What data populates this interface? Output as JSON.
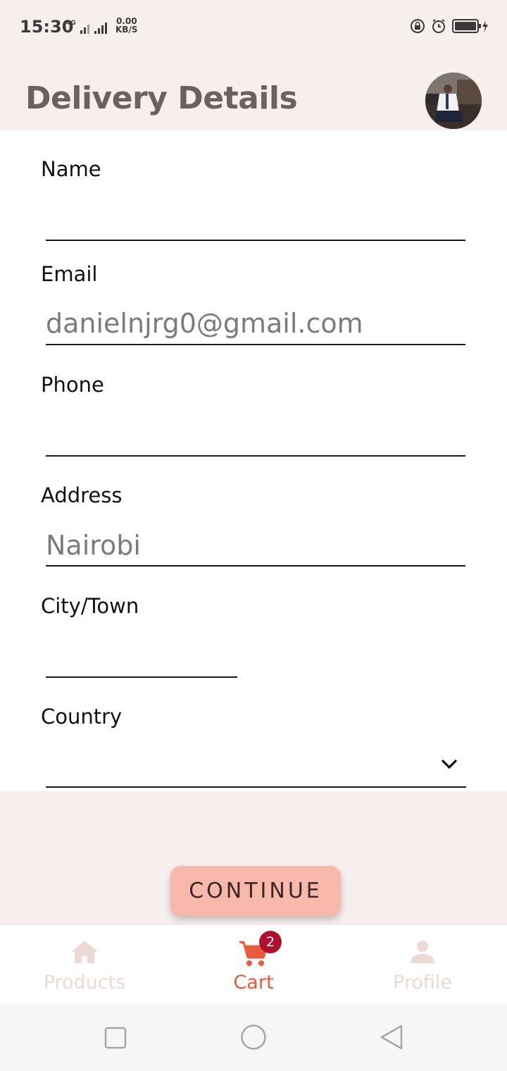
{
  "status_bar": {
    "time": "15:30",
    "network_type": "4G",
    "speed_value": "0.00",
    "speed_unit": "KB/S"
  },
  "header": {
    "title": "Delivery Details"
  },
  "form": {
    "fields": [
      {
        "label": "Name",
        "value": ""
      },
      {
        "label": "Email",
        "value": "danielnjrg0@gmail.com"
      },
      {
        "label": "Phone",
        "value": ""
      },
      {
        "label": "Address",
        "value": "Nairobi"
      },
      {
        "label": "City/Town",
        "value": ""
      },
      {
        "label": "Country",
        "value": ""
      }
    ]
  },
  "continue_label": "CONTINUE",
  "bottom_nav": {
    "items": [
      {
        "label": "Products",
        "icon": "home-icon",
        "active": false
      },
      {
        "label": "Cart",
        "icon": "cart-icon",
        "active": true,
        "badge": "2"
      },
      {
        "label": "Profile",
        "icon": "person-icon",
        "active": false
      }
    ]
  },
  "colors": {
    "background": "#f7efed",
    "title": "#6b6260",
    "accent": "#ea5a3c",
    "button": "#f8b8ac",
    "badge": "#b0102b",
    "inactive_nav": "#ecd9d6"
  }
}
